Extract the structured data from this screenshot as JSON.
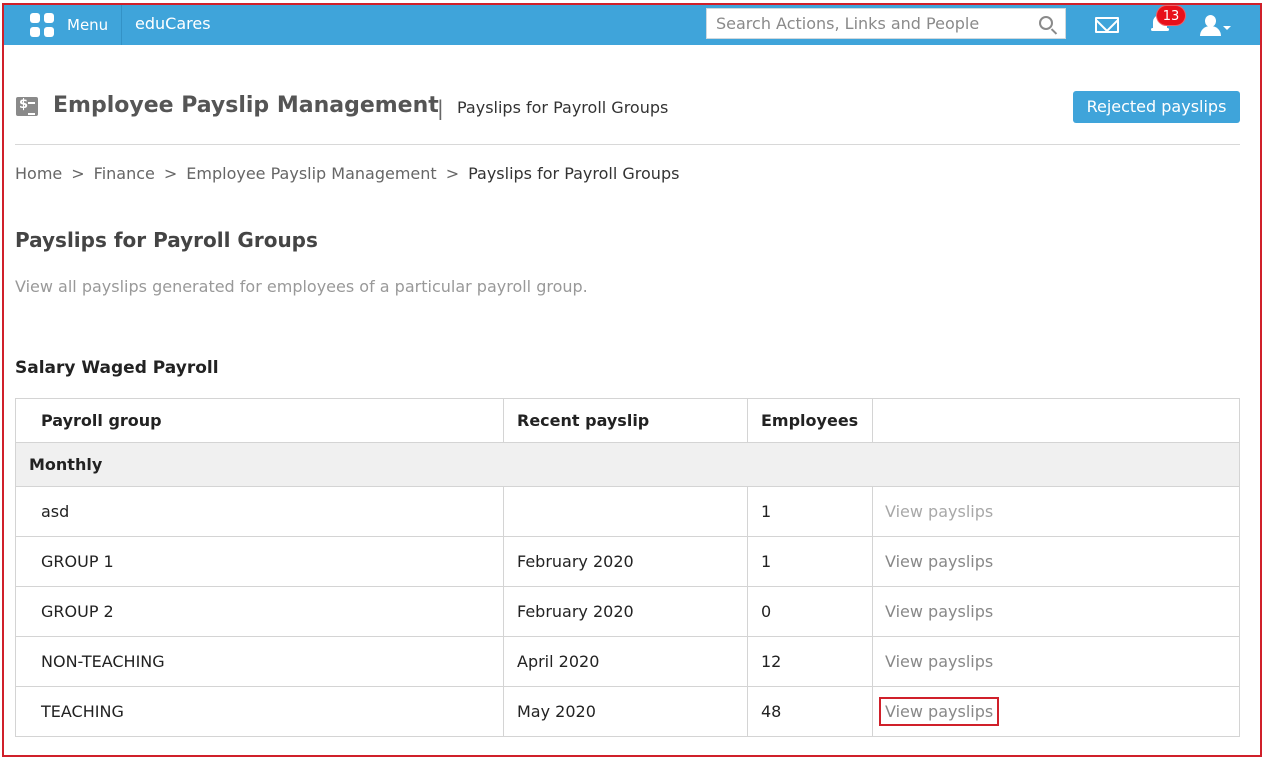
{
  "topbar": {
    "menu_label": "Menu",
    "brand": "eduCares",
    "search_placeholder": "Search Actions, Links and People",
    "notification_count": "13"
  },
  "header": {
    "title": "Employee Payslip Management",
    "separator": "|",
    "subtitle": "Payslips for Payroll Groups",
    "rejected_button": "Rejected payslips"
  },
  "breadcrumb": {
    "items": [
      "Home",
      "Finance",
      "Employee Payslip Management"
    ],
    "current": "Payslips for Payroll Groups",
    "separator": ">"
  },
  "main": {
    "title": "Payslips for Payroll Groups",
    "description": "View all payslips generated for employees of a particular payroll group.",
    "group_title": "Salary Waged Payroll"
  },
  "table": {
    "headers": [
      "Payroll group",
      "Recent payslip",
      "Employees",
      ""
    ],
    "group_label": "Monthly",
    "rows": [
      {
        "group": "asd",
        "recent": "",
        "employees": "1",
        "action": "View payslips"
      },
      {
        "group": "GROUP 1",
        "recent": "February 2020",
        "employees": "1",
        "action": "View payslips"
      },
      {
        "group": "GROUP 2",
        "recent": "February 2020",
        "employees": "0",
        "action": "View payslips"
      },
      {
        "group": "NON-TEACHING",
        "recent": "April 2020",
        "employees": "12",
        "action": "View payslips"
      },
      {
        "group": "TEACHING",
        "recent": "May 2020",
        "employees": "48",
        "action": "View payslips"
      }
    ]
  },
  "colors": {
    "topbar": "#3fa4da",
    "highlight": "#d0202a",
    "badge": "#e8101a"
  }
}
